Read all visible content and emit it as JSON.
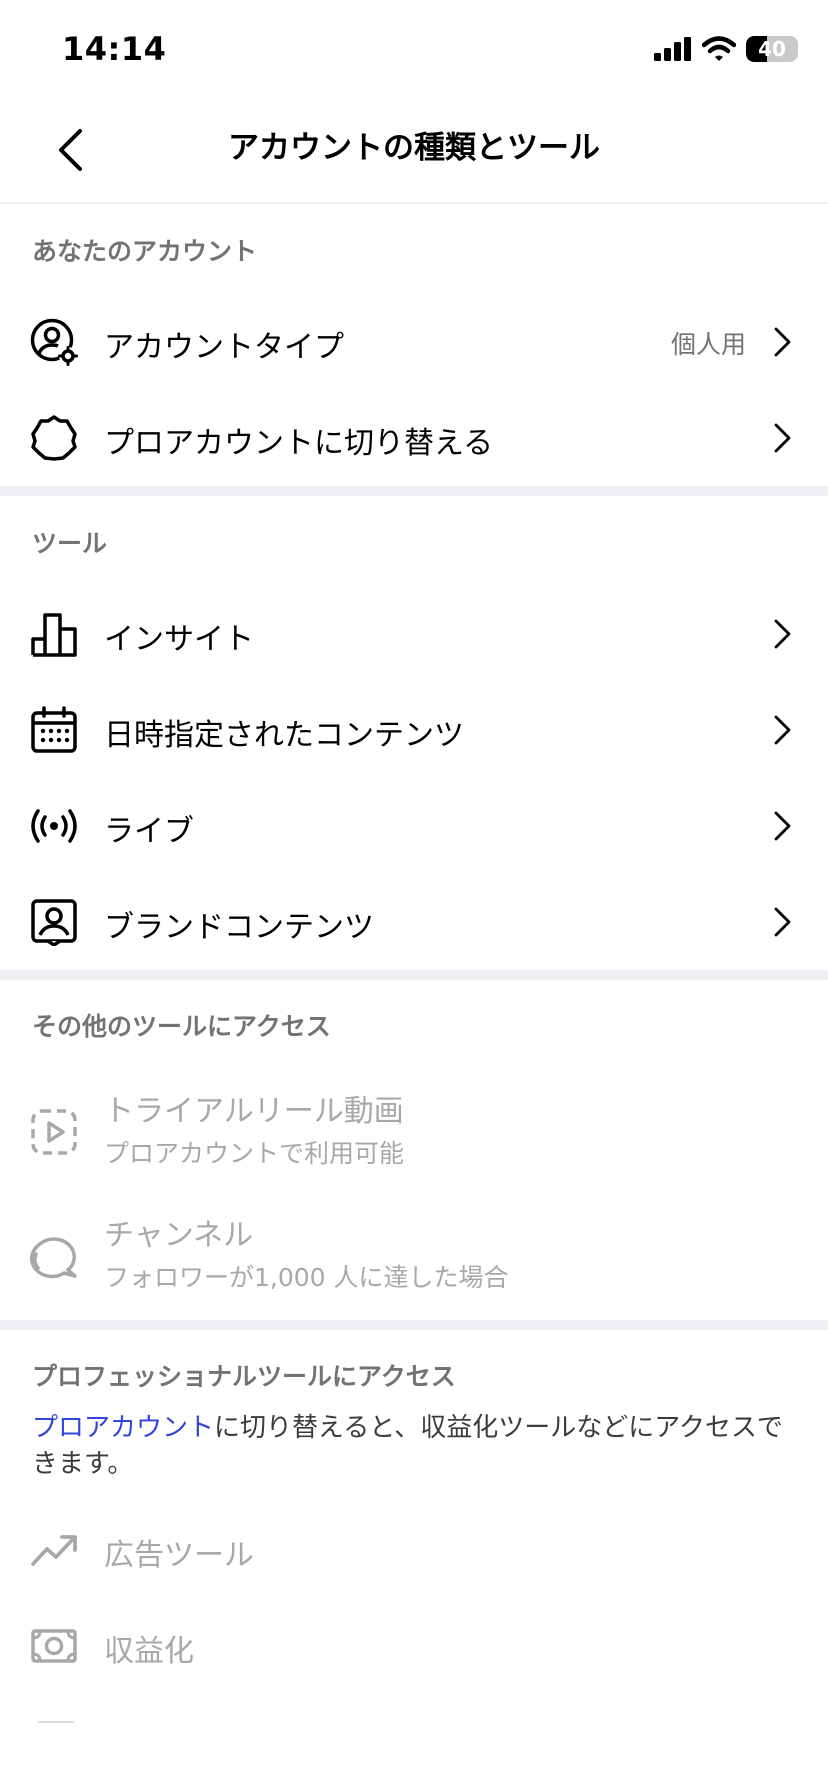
{
  "status_bar": {
    "time": "14:14",
    "battery_level": "40",
    "battery_fraction": 0.4
  },
  "header": {
    "title": "アカウントの種類とツール"
  },
  "account_section": {
    "header": "あなたのアカウント",
    "items": [
      {
        "label": "アカウントタイプ",
        "value": "個人用",
        "icon": "account-settings-icon"
      },
      {
        "label": "プロアカウントに切り替える",
        "icon": "gear-icon"
      }
    ]
  },
  "tools_section": {
    "header": "ツール",
    "items": [
      {
        "label": "インサイト",
        "icon": "bar-chart-icon"
      },
      {
        "label": "日時指定されたコンテンツ",
        "icon": "calendar-icon"
      },
      {
        "label": "ライブ",
        "icon": "live-broadcast-icon"
      },
      {
        "label": "ブランドコンテンツ",
        "icon": "branded-content-icon"
      }
    ]
  },
  "other_tools_section": {
    "header": "その他のツールにアクセス",
    "items": [
      {
        "label": "トライアルリール動画",
        "sublabel": "プロアカウントで利用可能",
        "icon": "trial-reel-icon"
      },
      {
        "label": "チャンネル",
        "sublabel": "フォロワーが1,000 人に達した場合",
        "icon": "channel-icon"
      }
    ]
  },
  "pro_tools_section": {
    "header": "プロフェッショナルツールにアクセス",
    "description_link": "プロアカウント",
    "description_rest": "に切り替えると、収益化ツールなどにアクセスできます。",
    "items": [
      {
        "label": "広告ツール",
        "icon": "trending-up-icon"
      },
      {
        "label": "収益化",
        "icon": "money-icon"
      }
    ]
  },
  "colors": {
    "link": "#3146d8",
    "secondary_text": "#737373",
    "disabled_text": "#a8a8a8",
    "divider": "#eff0f4"
  }
}
